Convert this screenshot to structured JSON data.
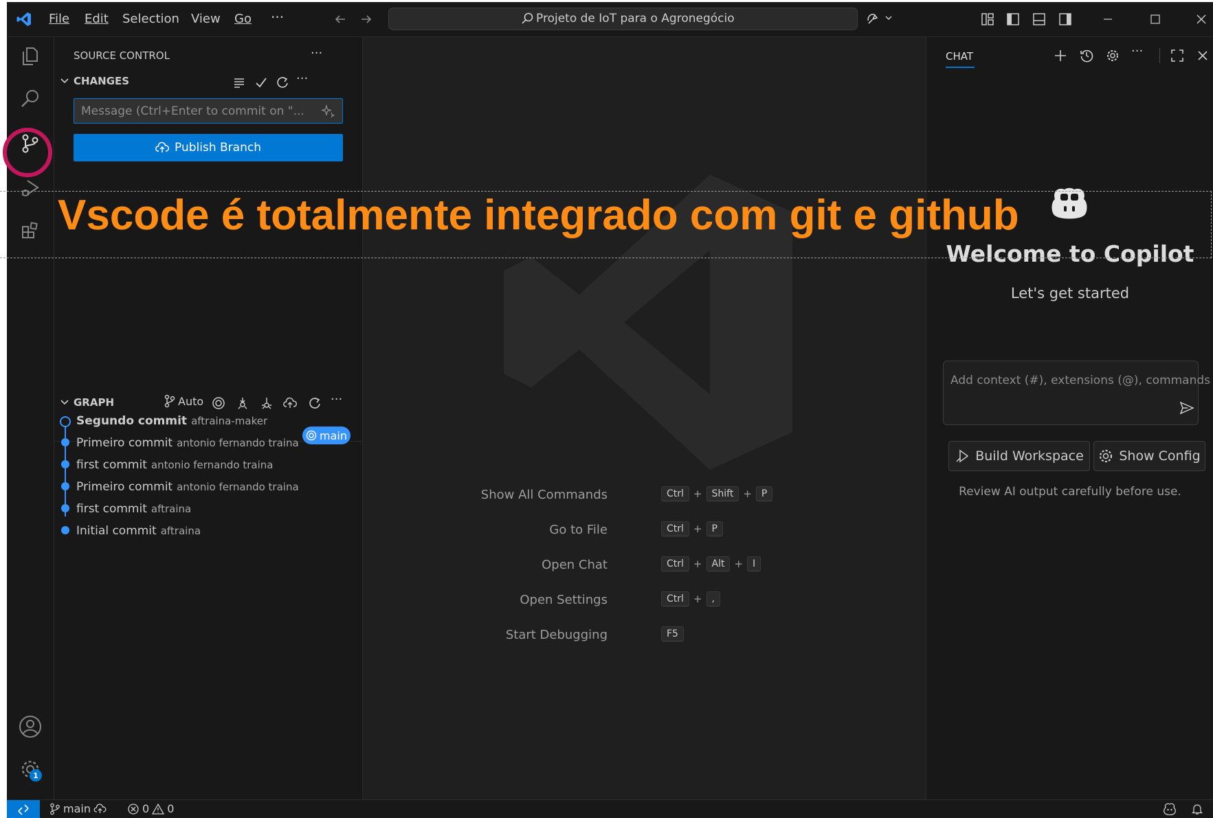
{
  "titlebar": {
    "menu": [
      "File",
      "Edit",
      "Selection",
      "View",
      "Go"
    ],
    "more": "···",
    "search_text": "Projeto de IoT para o Agronegócio"
  },
  "sidebar": {
    "title": "SOURCE CONTROL",
    "more": "···",
    "changes_label": "CHANGES",
    "message_placeholder": "Message (Ctrl+Enter to commit on \"...",
    "publish_label": "Publish Branch",
    "graph_label": "GRAPH",
    "graph_auto": "Auto",
    "commits": [
      {
        "message": "Segundo commit",
        "author": "aftraina-maker"
      },
      {
        "message": "Primeiro  commit",
        "author": "antonio fernando traina"
      },
      {
        "message": "first commit",
        "author": "antonio fernando traina"
      },
      {
        "message": "Primeiro commit",
        "author": "antonio fernando traina"
      },
      {
        "message": "first commit",
        "author": "aftraina"
      },
      {
        "message": "Initial commit",
        "author": "aftraina"
      }
    ],
    "branch_badge": "main"
  },
  "activity": {
    "settings_badge": "1"
  },
  "editor": {
    "shortcuts": [
      {
        "label": "Show All Commands",
        "keys": [
          "Ctrl",
          "Shift",
          "P"
        ]
      },
      {
        "label": "Go to File",
        "keys": [
          "Ctrl",
          "P"
        ]
      },
      {
        "label": "Open Chat",
        "keys": [
          "Ctrl",
          "Alt",
          "I"
        ]
      },
      {
        "label": "Open Settings",
        "keys": [
          "Ctrl",
          ","
        ]
      },
      {
        "label": "Start Debugging",
        "keys": [
          "F5"
        ]
      }
    ]
  },
  "chat": {
    "tab_label": "CHAT",
    "welcome_title": "Welcome to Copilot",
    "welcome_subtitle": "Let's get started",
    "input_placeholder": "Add context (#), extensions (@), commands",
    "build_workspace": "Build Workspace",
    "show_config": "Show Config",
    "disclaimer": "Review AI output carefully before use."
  },
  "statusbar": {
    "branch": "main",
    "errors": "0",
    "warnings": "0"
  },
  "overlay": {
    "caption": "Vscode é totalmente integrado com git e github"
  },
  "colors": {
    "accent": "#0078d4",
    "graph_blue": "#3794ff",
    "caption_orange": "#ff8c14",
    "highlight_ring": "#c2185b"
  }
}
